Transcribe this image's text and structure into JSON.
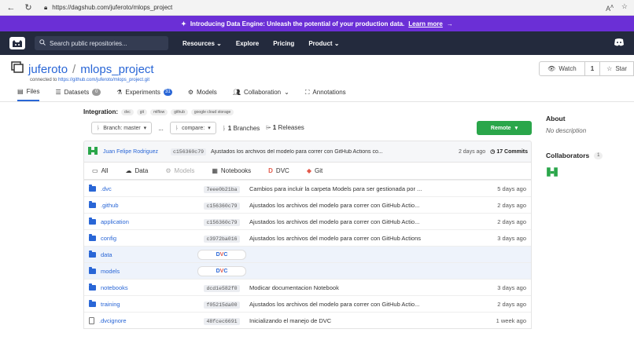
{
  "browser": {
    "url": "https://dagshub.com/juferoto/mlops_project"
  },
  "announcement": {
    "text": "Introducing Data Engine: Unleash the potential of your production data.",
    "link": "Learn more",
    "arrow": "→"
  },
  "header": {
    "search_placeholder": "Search public repositories...",
    "nav": [
      "Resources",
      "Explore",
      "Pricing",
      "Product"
    ]
  },
  "repo": {
    "owner": "juferoto",
    "separator": "/",
    "name": "mlops_project",
    "connected_label": "connected to",
    "connected_url": "https://github.com/juferoto/mlops_project.git",
    "watch_label": "Watch",
    "watch_count": "1",
    "star_label": "Star"
  },
  "tabs": [
    {
      "label": "Files"
    },
    {
      "label": "Datasets",
      "badge": "0"
    },
    {
      "label": "Experiments",
      "badge": "31"
    },
    {
      "label": "Models"
    },
    {
      "label": "Collaboration"
    },
    {
      "label": "Annotations"
    }
  ],
  "integration": {
    "label": "Integration:",
    "chips": [
      "dvc",
      "git",
      "mlflow",
      "github",
      "google cloud storage"
    ]
  },
  "controls": {
    "branch_select": "Branch: master",
    "dash": "...",
    "compare_select": "compare:",
    "branches_count": "1",
    "branches_label": "Branches",
    "releases_count": "1",
    "releases_label": "Releases",
    "remote_label": "Remote"
  },
  "last_commit": {
    "author": "Juan Felipe Rodriguez",
    "sha": "c156360c79",
    "message": "Ajustados los archivos del modelo para correr con GitHub Actions co...",
    "time": "2 days ago",
    "count": "17 Commits"
  },
  "filters": [
    "All",
    "Data",
    "Models",
    "Notebooks",
    "DVC",
    "Git"
  ],
  "files": [
    {
      "name": ".dvc",
      "kind": "folder",
      "sha": "7eee0b21ba",
      "msg": "Cambios para incluir la carpeta Models para ser gestionada por ...",
      "age": "5 days ago"
    },
    {
      "name": ".github",
      "kind": "folder",
      "sha": "c156360c79",
      "msg": "Ajustados los archivos del modelo para correr con GitHub Actio...",
      "age": "2 days ago"
    },
    {
      "name": "application",
      "kind": "folder",
      "sha": "c156360c79",
      "msg": "Ajustados los archivos del modelo para correr con GitHub Actio...",
      "age": "2 days ago"
    },
    {
      "name": "config",
      "kind": "folder",
      "sha": "c3972ba016",
      "msg": "Ajustados los archivos del modelo para correr con GitHub Actions",
      "age": "3 days ago"
    },
    {
      "name": "data",
      "kind": "dvc",
      "sha": "",
      "msg": "",
      "age": ""
    },
    {
      "name": "models",
      "kind": "dvc",
      "sha": "",
      "msg": "",
      "age": ""
    },
    {
      "name": "notebooks",
      "kind": "folder",
      "sha": "dcd1e582f0",
      "msg": "Modicar documentacion Notebook",
      "age": "3 days ago"
    },
    {
      "name": "training",
      "kind": "folder",
      "sha": "f05215da00",
      "msg": "Ajustados los archivos del modelo para correr con GitHub Actio...",
      "age": "2 days ago"
    },
    {
      "name": ".dvcignore",
      "kind": "file",
      "sha": "48fcec6691",
      "msg": "Inicializando el manejo de DVC",
      "age": "1 week ago"
    }
  ],
  "sidebar": {
    "about_title": "About",
    "about_desc": "No description",
    "collaborators_title": "Collaborators",
    "collaborators_count": "1"
  },
  "colors": {
    "accent": "#2966d6",
    "remote": "#2aa64a",
    "banner": "#6b2fd6",
    "header": "#232a3d"
  }
}
